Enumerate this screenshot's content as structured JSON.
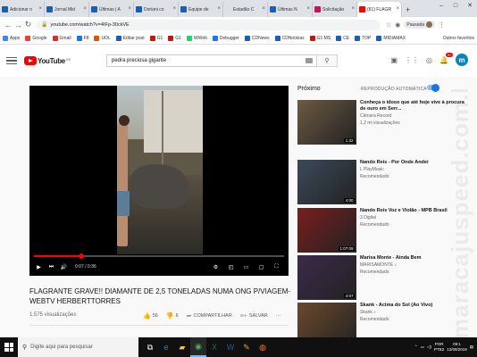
{
  "browser": {
    "tabs": [
      {
        "label": "Adicionar n",
        "color": "#1a5fb4"
      },
      {
        "label": "Jornal Mid",
        "color": "#1a5fb4"
      },
      {
        "label": "Últimas | A",
        "color": "#1a5fb4"
      },
      {
        "label": "Doriani co",
        "color": "#1a5fb4"
      },
      {
        "label": "Equipe de",
        "color": "#1a5fb4"
      },
      {
        "label": "Estadão C",
        "color": "#e0e0e0"
      },
      {
        "label": "Últimas N",
        "color": "#1a5fb4"
      },
      {
        "label": "Solicitação",
        "color": "#c2185b"
      },
      {
        "label": "(81) FLAGR",
        "color": "#ff0000",
        "active": true
      }
    ],
    "url": "youtube.com/watch?v=4IFp-30ckVE",
    "profile_label": "Pausada",
    "bookmarks": [
      {
        "label": "Apps",
        "color": "#4285f4"
      },
      {
        "label": "Google",
        "color": "#ea4335"
      },
      {
        "label": "Gmail",
        "color": "#d93025"
      },
      {
        "label": "F8",
        "color": "#1a73e8"
      },
      {
        "label": "UOL",
        "color": "#e65100"
      },
      {
        "label": "Editar post",
        "color": "#1a5fb4"
      },
      {
        "label": "G1",
        "color": "#c4170c"
      },
      {
        "label": "G1",
        "color": "#c4170c"
      },
      {
        "label": "WWeb",
        "color": "#25d366"
      },
      {
        "label": "Debugger",
        "color": "#1877f2"
      },
      {
        "label": "CDNews",
        "color": "#1a5fb4"
      },
      {
        "label": "CDNoticias",
        "color": "#1a5fb4"
      },
      {
        "label": "G1 MS",
        "color": "#c4170c"
      },
      {
        "label": "CE",
        "color": "#1a5fb4"
      },
      {
        "label": "TOP",
        "color": "#1a5fb4"
      },
      {
        "label": "MIDIAMAX",
        "color": "#1a5fb4"
      }
    ],
    "bookmarks_other": "Outros favoritos"
  },
  "youtube": {
    "logo_text": "YouTube",
    "logo_country": "BR",
    "search_value": "pedra preciosa gigante",
    "notification_count": "9+",
    "avatar_letter": "m",
    "video": {
      "title": "FLAGRANTE GRAVE!! DIAMANTE DE 2,5 TONELADAS NUMA ONG P/VIAGEM-WEBTV HERBERTTORRES",
      "views": "1.575 visualizações",
      "time_current": "0:07",
      "time_total": "0:36",
      "progress_fraction": 0.19,
      "likes": "56",
      "dislikes": "6",
      "share_label": "COMPARTILHAR",
      "save_label": "SALVAR"
    },
    "next_label": "Próximo",
    "autoplay_label": "REPRODUÇÃO AUTOMÁTICA",
    "recommendations": [
      {
        "title": "Conheça o idoso que até hoje vive à procura de ouro em Serr...",
        "channel": "Câmara Record",
        "meta": "1,2 mi visualizações",
        "duration": "1:32",
        "thumb_color": "#6d5a43"
      },
      {
        "title": "Nando Reis - Por Onde Andei",
        "channel": "L PlayMusic",
        "meta": "Recomendado",
        "duration": "4:00",
        "thumb_color": "#3b4a5a"
      },
      {
        "title": "Nando Reis Voz e Violão - MPB Brasil",
        "channel": "3 Digital",
        "meta": "Recomendado",
        "duration": "1:07:09",
        "thumb_color": "#7a1d1d"
      },
      {
        "title": "Marisa Monte - Ainda Bem",
        "channel": "MARISAMONTE ♪",
        "meta": "Recomendado",
        "duration": "4:07",
        "thumb_color": "#3b2a4a"
      },
      {
        "title": "Skank - Acima do Sol (Ao Vivo)",
        "channel": "Skank ♪",
        "meta": "Recomendado",
        "duration": "",
        "thumb_color": "#6b4a2e"
      }
    ]
  },
  "taskbar": {
    "search_placeholder": "Digite aqui para pesquisar",
    "lang": "POR",
    "layout": "PTB2",
    "time": "09:1",
    "date": "12/09/2019"
  },
  "watermark": "maracajuspeed.com.br"
}
